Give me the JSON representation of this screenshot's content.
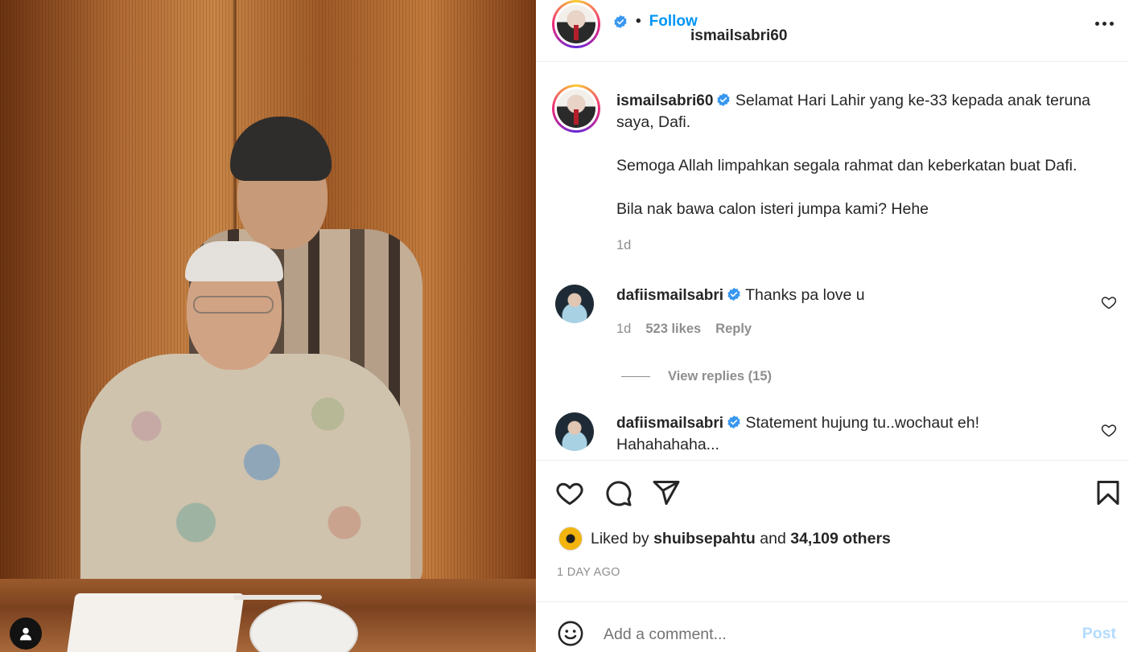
{
  "post": {
    "author": "ismailsabri60",
    "follow_label": "Follow",
    "separator": "•",
    "caption_lines": [
      "Selamat Hari Lahir yang ke-33 kepada anak teruna saya, Dafi.",
      "Semoga Allah limpahkan segala rahmat dan keberkatan buat Dafi.",
      "Bila nak bawa calon isteri jumpa kami? Hehe"
    ],
    "caption_time": "1d"
  },
  "comments": [
    {
      "username": "dafiismailsabri",
      "text": "Thanks pa love u",
      "time": "1d",
      "likes": "523 likes",
      "reply_label": "Reply",
      "view_replies": "View replies (15)"
    },
    {
      "username": "dafiismailsabri",
      "text": "Statement hujung tu..wochaut eh! Hahahahaha..."
    }
  ],
  "likes": {
    "prefix": "Liked by",
    "user": "shuibsepahtu",
    "middle": "and",
    "others": "34,109 others"
  },
  "timestamp": "1 DAY AGO",
  "composer": {
    "placeholder": "Add a comment...",
    "post_label": "Post"
  },
  "colors": {
    "accent": "#0095f6",
    "verified": "#3897f0",
    "muted": "#8e8e8e",
    "post_disabled": "#b3dbff"
  },
  "icons": [
    "verified-badge-icon",
    "more-options-icon",
    "heart-icon",
    "comment-icon",
    "share-icon",
    "bookmark-icon",
    "emoji-icon",
    "user-tag-icon"
  ]
}
